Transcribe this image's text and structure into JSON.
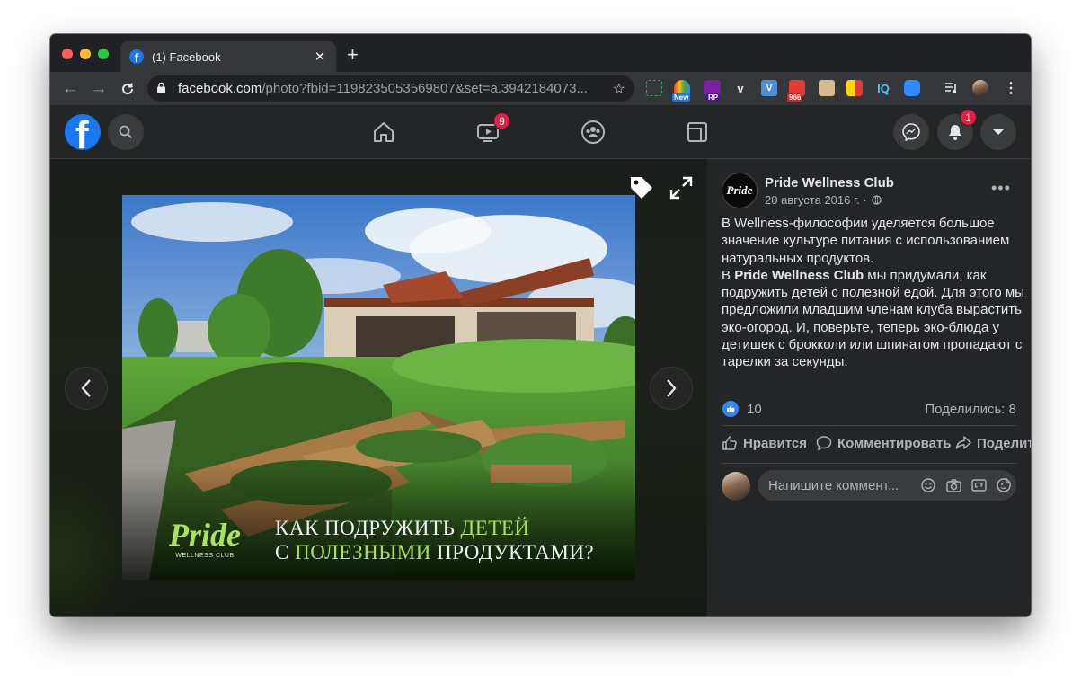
{
  "browser": {
    "tab_title": "(1) Facebook",
    "new_tab_symbol": "+",
    "url_host": "facebook.com",
    "url_path": "/photo?fbid=1198235053569807&set=a.3942184073...",
    "extensions": [
      {
        "name": "screenshot-ext-icon",
        "badge": ""
      },
      {
        "name": "rainbow-ext-icon",
        "badge": "New"
      },
      {
        "name": "rp-ext-icon",
        "badge": "RP"
      },
      {
        "name": "v-ext-icon",
        "badge": "v"
      },
      {
        "name": "check-ext-icon",
        "badge": ""
      },
      {
        "name": "mail-ext-icon",
        "badge": "966"
      },
      {
        "name": "robot-ext-icon",
        "badge": ""
      },
      {
        "name": "bookmark-ext-icon",
        "badge": ""
      },
      {
        "name": "iq-ext-icon",
        "badge": "IQ"
      },
      {
        "name": "zoom-ext-icon",
        "badge": ""
      }
    ]
  },
  "fb": {
    "watch_badge": "9",
    "notifications_badge": "1"
  },
  "photo": {
    "caption_line1_a": "КАК ПОДРУЖИТЬ ",
    "caption_line1_b": "ДЕТЕЙ",
    "caption_line2_a": "С ",
    "caption_line2_b": "ПОЛЕЗНЫМИ",
    "caption_line2_c": " ПРОДУКТАМИ?",
    "logo_text": "Pride",
    "logo_subtext": "WELLNESS CLUB"
  },
  "post": {
    "page_name": "Pride Wellness Club",
    "date": "20 августа 2016 г. ·",
    "avatar_text": "Pride",
    "text_p1": "В Wellness-философии уделяется большое значение культуре питания с использованием натуральных продуктов.",
    "text_p2_a": "В ",
    "text_p2_bold": "Pride Wellness Club",
    "text_p2_b": " мы придумали, как подружить детей с полезной едой. Для этого мы предложили младшим членам клуба вырастить эко-огород. И, поверьте, теперь эко-блюда у детишек с брокколи или шпинатом пропадают с тарелки за секунды.",
    "likes_count": "10",
    "shares": "Поделились: 8",
    "action_like": "Нравится",
    "action_comment": "Комментировать",
    "action_share": "Поделиться",
    "comment_placeholder": "Напишите коммент..."
  }
}
